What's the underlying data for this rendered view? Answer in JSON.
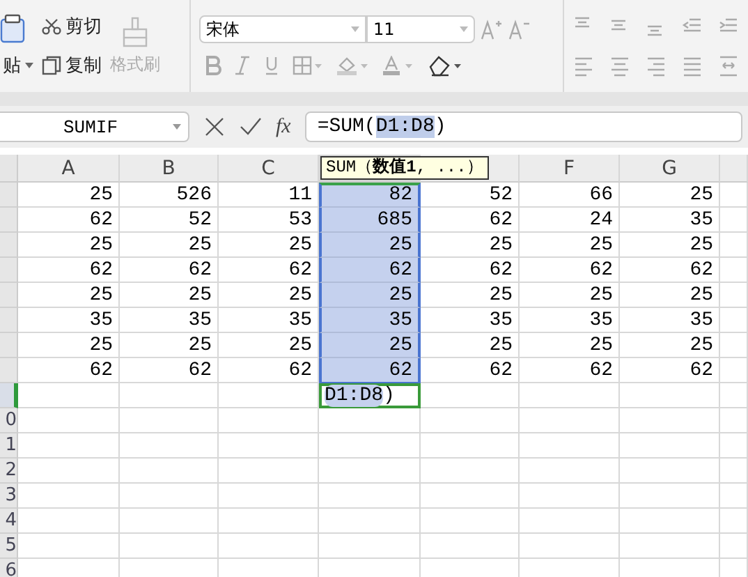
{
  "ribbon": {
    "paste": {
      "label": "贴"
    },
    "cut": {
      "label": "剪切"
    },
    "copy": {
      "label": "复制"
    },
    "format_painter": {
      "label": "格式刷",
      "disabled": true
    },
    "font": {
      "name": "宋体",
      "size": "11"
    }
  },
  "formula_bar": {
    "name_box": "SUMIF",
    "fx": "fx",
    "formula": {
      "prefix": "=SUM(",
      "ref": "D1:D8",
      "suffix": ")"
    }
  },
  "tooltip": "SUM（**数值1**, ...）",
  "columns": [
    {
      "label": "A",
      "selected": false
    },
    {
      "label": "B",
      "selected": false
    },
    {
      "label": "C",
      "selected": false
    },
    {
      "selected": true
    },
    {
      "selected": false
    },
    {
      "label": "F",
      "selected": false
    },
    {
      "label": "G",
      "selected": false
    }
  ],
  "rows": [
    {
      "in_range": true,
      "active": false,
      "cells": [
        "25",
        "526",
        "11",
        "82",
        "52",
        "66",
        "25"
      ]
    },
    {
      "in_range": true,
      "active": false,
      "cells": [
        "62",
        "52",
        "53",
        "685",
        "62",
        "24",
        "35"
      ]
    },
    {
      "in_range": true,
      "active": false,
      "cells": [
        "25",
        "25",
        "25",
        "25",
        "25",
        "25",
        "25"
      ]
    },
    {
      "in_range": true,
      "active": false,
      "cells": [
        "62",
        "62",
        "62",
        "62",
        "62",
        "62",
        "62"
      ]
    },
    {
      "in_range": true,
      "active": false,
      "cells": [
        "25",
        "25",
        "25",
        "25",
        "25",
        "25",
        "25"
      ]
    },
    {
      "in_range": true,
      "active": false,
      "cells": [
        "35",
        "35",
        "35",
        "35",
        "35",
        "35",
        "35"
      ]
    },
    {
      "in_range": true,
      "active": false,
      "cells": [
        "25",
        "25",
        "25",
        "25",
        "25",
        "25",
        "25"
      ]
    },
    {
      "in_range": true,
      "active": false,
      "cells": [
        "62",
        "62",
        "62",
        "62",
        "62",
        "62",
        "62"
      ]
    },
    {
      "in_range": false,
      "active": true,
      "edit": {
        "ref": "D1:D8",
        "suffix": ")"
      }
    },
    {
      "in_range": false,
      "active": false,
      "header": "0"
    },
    {
      "in_range": false,
      "active": false,
      "header": "1"
    },
    {
      "in_range": false,
      "active": false,
      "header": "2"
    },
    {
      "in_range": false,
      "active": false,
      "header": "3"
    },
    {
      "in_range": false,
      "active": false,
      "header": "4"
    },
    {
      "in_range": false,
      "active": false,
      "header": "5"
    },
    {
      "in_range": false,
      "active": false,
      "header": "6"
    }
  ]
}
